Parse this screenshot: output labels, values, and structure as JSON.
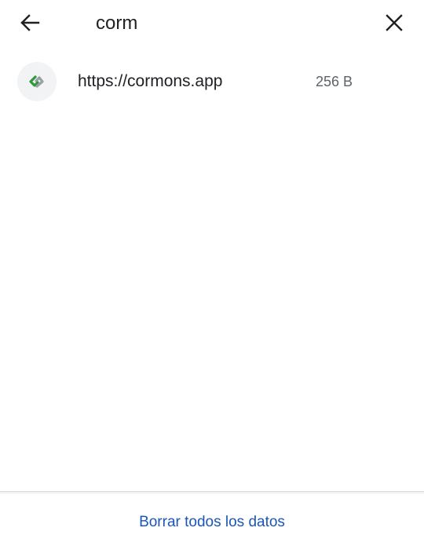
{
  "search": {
    "value": "corm",
    "back_icon": "arrow-left-icon",
    "clear_icon": "close-icon"
  },
  "sites": [
    {
      "url": "https://cormons.app",
      "size": "256 B",
      "icon": "cormons-favicon-icon"
    }
  ],
  "footer": {
    "clear_all_label": "Borrar todos los datos"
  },
  "colors": {
    "accent": "#1a56b8",
    "text_primary": "#202124",
    "text_secondary": "#5f6368",
    "favicon_bg": "#f1f3f4",
    "favicon_green": "#2e9a3b",
    "favicon_gray": "#9aa0a6"
  }
}
